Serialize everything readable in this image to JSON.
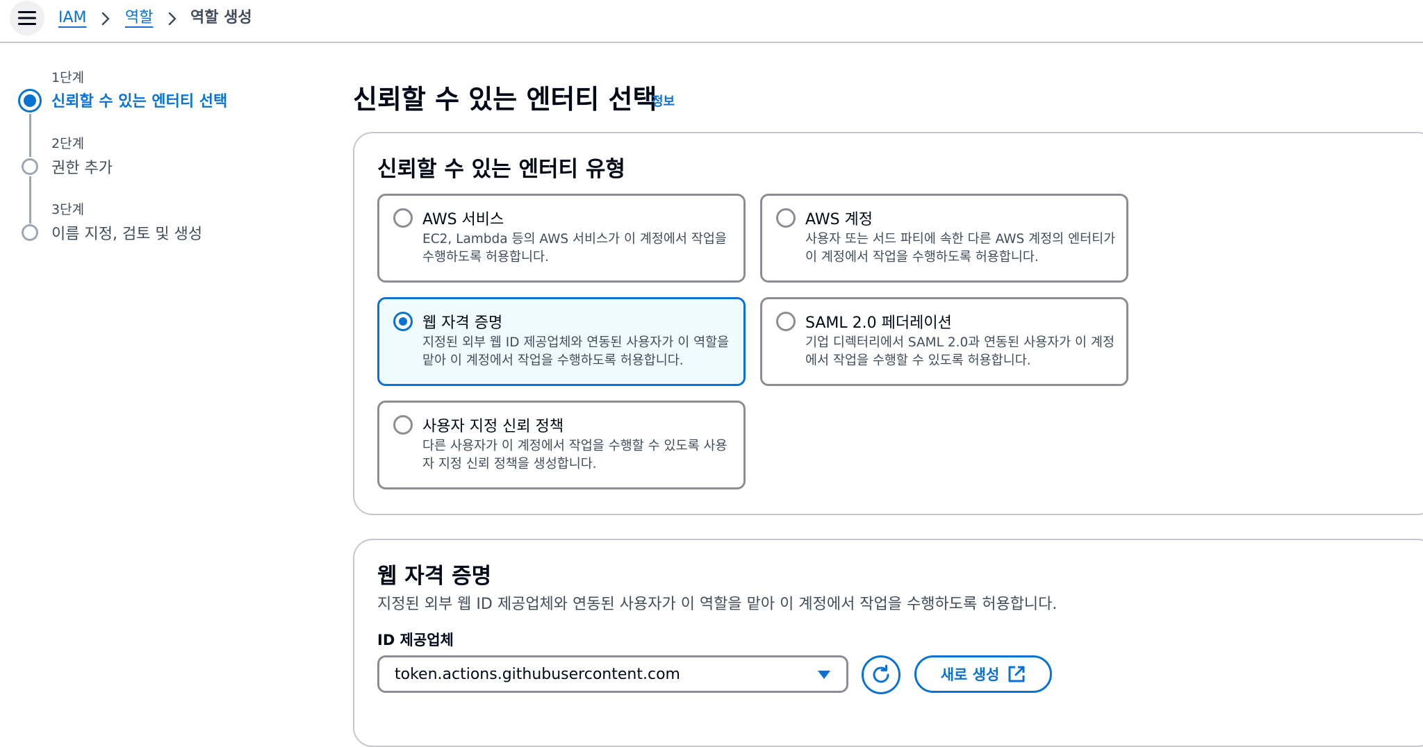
{
  "header": {
    "breadcrumbs": [
      {
        "label": "IAM"
      },
      {
        "label": "역할"
      },
      {
        "label": "역할 생성"
      }
    ]
  },
  "steps": [
    {
      "number": "1단계",
      "title": "신뢰할 수 있는 엔터티 선택",
      "active": true
    },
    {
      "number": "2단계",
      "title": "권한 추가",
      "active": false
    },
    {
      "number": "3단계",
      "title": "이름 지정, 검토 및 생성",
      "active": false
    }
  ],
  "page": {
    "title": "신뢰할 수 있는 엔터티 선택",
    "info": "정보"
  },
  "entity_type": {
    "title": "신뢰할 수 있는 엔터티 유형",
    "options": [
      {
        "title": "AWS 서비스",
        "desc": "EC2, Lambda 등의 AWS 서비스가 이 계정에서 작업을 수행하도록 허용합니다.",
        "selected": false
      },
      {
        "title": "AWS 계정",
        "desc": "사용자 또는 서드 파티에 속한 다른 AWS 계정의 엔터티가 이 계정에서 작업을 수행하도록 허용합니다.",
        "selected": false
      },
      {
        "title": "웹 자격 증명",
        "desc": "지정된 외부 웹 ID 제공업체와 연동된 사용자가 이 역할을 맡아 이 계정에서 작업을 수행하도록 허용합니다.",
        "selected": true
      },
      {
        "title": "SAML 2.0 페더레이션",
        "desc": "기업 디렉터리에서 SAML 2.0과 연동된 사용자가 이 계정에서 작업을 수행할 수 있도록 허용합니다.",
        "selected": false
      },
      {
        "title": "사용자 지정 신뢰 정책",
        "desc": "다른 사용자가 이 계정에서 작업을 수행할 수 있도록 사용자 지정 신뢰 정책을 생성합니다.",
        "selected": false
      }
    ]
  },
  "web_identity": {
    "title": "웹 자격 증명",
    "desc": "지정된 외부 웹 ID 제공업체와 연동된 사용자가 이 역할을 맡아 이 계정에서 작업을 수행하도록 허용합니다.",
    "provider_label": "ID 제공업체",
    "provider_value": "token.actions.githubusercontent.com",
    "new_label": "새로 생성"
  },
  "icons": {
    "menu": "menu-icon",
    "chevron": "chevron-right-icon",
    "caret": "caret-down-icon",
    "refresh": "refresh-icon",
    "external": "external-link-icon"
  },
  "colors": {
    "accent": "#0972d3",
    "selected_bg": "#f0fbff",
    "border": "#8c8c94",
    "text": "#000716",
    "muted": "#414d5c"
  }
}
